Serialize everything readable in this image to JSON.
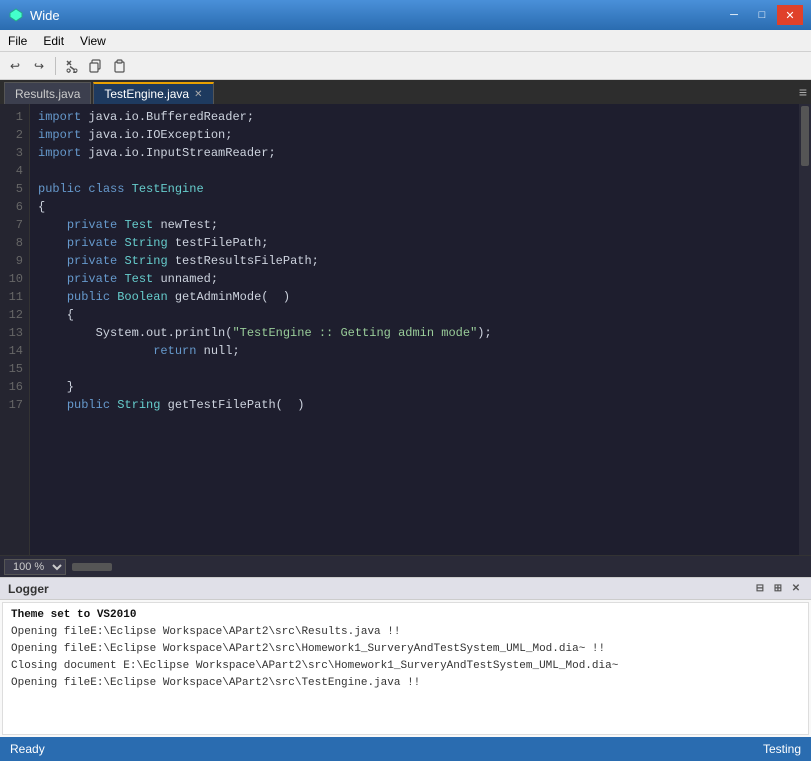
{
  "titleBar": {
    "title": "Wide",
    "iconSymbol": "◆",
    "minimizeLabel": "─",
    "maximizeLabel": "□",
    "closeLabel": "✕"
  },
  "menuBar": {
    "items": [
      "File",
      "Edit",
      "View"
    ]
  },
  "toolbar": {
    "buttons": [
      {
        "name": "undo-icon",
        "symbol": "↩"
      },
      {
        "name": "redo-icon",
        "symbol": "↪"
      },
      {
        "name": "cut-icon",
        "symbol": "✂"
      },
      {
        "name": "copy-icon",
        "symbol": "⧉"
      },
      {
        "name": "paste-icon",
        "symbol": "📋"
      }
    ]
  },
  "tabs": [
    {
      "label": "Results.java",
      "active": false,
      "closeable": false
    },
    {
      "label": "TestEngine.java",
      "active": true,
      "closeable": true
    }
  ],
  "editor": {
    "lines": [
      {
        "num": 1,
        "text": "import java.io.BufferedReader;"
      },
      {
        "num": 2,
        "text": "import java.io.IOException;"
      },
      {
        "num": 3,
        "text": "import java.io.InputStreamReader;"
      },
      {
        "num": 4,
        "text": ""
      },
      {
        "num": 5,
        "text": "public class TestEngine"
      },
      {
        "num": 6,
        "text": "{"
      },
      {
        "num": 7,
        "text": "    private Test newTest;"
      },
      {
        "num": 8,
        "text": "    private String testFilePath;"
      },
      {
        "num": 9,
        "text": "    private String testResultsFilePath;"
      },
      {
        "num": 10,
        "text": "    private Test unnamed;"
      },
      {
        "num": 11,
        "text": "    public Boolean getAdminMode(  )"
      },
      {
        "num": 12,
        "text": "    {"
      },
      {
        "num": 13,
        "text": "        System.out.println(\"TestEngine :: Getting admin mode\");"
      },
      {
        "num": 14,
        "text": "            return null;"
      },
      {
        "num": 15,
        "text": ""
      },
      {
        "num": 16,
        "text": "    }"
      },
      {
        "num": 17,
        "text": "    public String getTestFilePath(  )"
      }
    ],
    "zoom": "100 %"
  },
  "logger": {
    "title": "Logger",
    "lines": [
      {
        "text": "Theme set to VS2010",
        "bold": true
      },
      {
        "text": "Opening fileE:\\Eclipse Workspace\\APart2\\src\\Results.java !!",
        "bold": false
      },
      {
        "text": "Opening fileE:\\Eclipse Workspace\\APart2\\src\\Homework1_SurveryAndTestSystem_UML_Mod.dia~ !!",
        "bold": false
      },
      {
        "text": "Closing document E:\\Eclipse Workspace\\APart2\\src\\Homework1_SurveryAndTestSystem_UML_Mod.dia~",
        "bold": false
      },
      {
        "text": "Opening fileE:\\Eclipse Workspace\\APart2\\src\\TestEngine.java !!",
        "bold": false
      }
    ],
    "controls": [
      "⊟",
      "⊞",
      "✕"
    ]
  },
  "statusBar": {
    "left": "Ready",
    "right": "Testing"
  }
}
